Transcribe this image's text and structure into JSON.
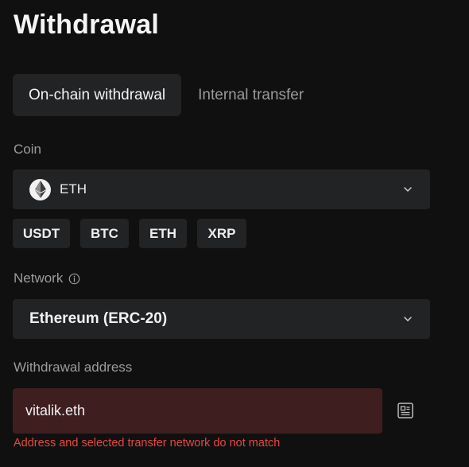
{
  "header": {
    "title": "Withdrawal"
  },
  "tabs": [
    {
      "label": "On-chain withdrawal",
      "active": true
    },
    {
      "label": "Internal transfer",
      "active": false
    }
  ],
  "coin": {
    "label": "Coin",
    "selected": {
      "symbol": "ETH",
      "icon": "ethereum-icon"
    },
    "quick_picks": [
      "USDT",
      "BTC",
      "ETH",
      "XRP"
    ]
  },
  "network": {
    "label": "Network",
    "info_icon": "info-icon",
    "selected": "Ethereum (ERC-20)"
  },
  "address": {
    "label": "Withdrawal address",
    "value": "vitalik.eth",
    "error": "Address and selected transfer network do not match",
    "address_book_icon": "address-book-icon"
  },
  "colors": {
    "background": "#101010",
    "surface": "#222325",
    "error_surface": "#3f1e20",
    "error_text": "#e84545",
    "muted_text": "#9b9b9b"
  }
}
